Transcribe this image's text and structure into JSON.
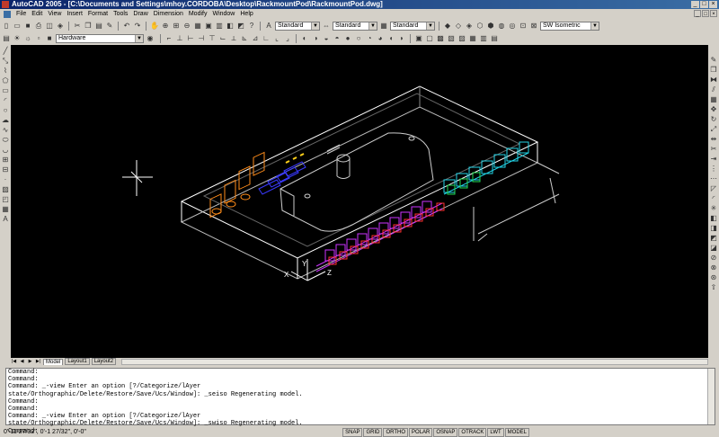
{
  "window": {
    "title": "AutoCAD 2005 - [C:\\Documents and Settings\\mhoy.CORDOBA\\Desktop\\RackmountPod\\RackmountPod.dwg]",
    "controls": [
      "_",
      "□",
      "×"
    ]
  },
  "menu": {
    "items": [
      "File",
      "Edit",
      "View",
      "Insert",
      "Format",
      "Tools",
      "Draw",
      "Dimension",
      "Modify",
      "Window",
      "Help"
    ]
  },
  "toolbar": {
    "text_style": "Standard",
    "dim_style": "Standard",
    "table_style": "Standard",
    "view": "SW Isometric",
    "layer": "Hardware"
  },
  "layout_tabs": {
    "tabs": [
      "Model",
      "Layout1",
      "Layout2"
    ],
    "active": "Model"
  },
  "command_window": {
    "lines": [
      "Command:",
      "Command:",
      "Command: _-view Enter an option [?/Categorize/lAyer",
      "state/Orthographic/Delete/Restore/Save/Ucs/Window]: _seiso Regenerating model.",
      "Command:",
      "Command:",
      "Command: _-view Enter an option [?/Categorize/lAyer",
      "state/Orthographic/Delete/Restore/Save/Ucs/Window]: _swiso Regenerating model.",
      "",
      "Command:"
    ]
  },
  "status": {
    "coords": "0'-11 27/32\", 0'-1 27/32\", 0'-0\"",
    "toggles": [
      "SNAP",
      "GRID",
      "ORTHO",
      "POLAR",
      "OSNAP",
      "OTRACK",
      "LWT",
      "MODEL"
    ]
  },
  "colors": {
    "title_start": "#0a246a",
    "title_end": "#3a6ea5",
    "canvas": "#000000",
    "ui_face": "#d4d0c8",
    "drawing_white": "#ffffff",
    "part_orange": "#ff8c1a",
    "part_blue": "#3a3aff",
    "part_magenta": "#cc33ff",
    "part_red": "#ff3030",
    "part_cyan": "#22d3e6",
    "part_green": "#22dd55",
    "part_yellow": "#ffd21a"
  }
}
